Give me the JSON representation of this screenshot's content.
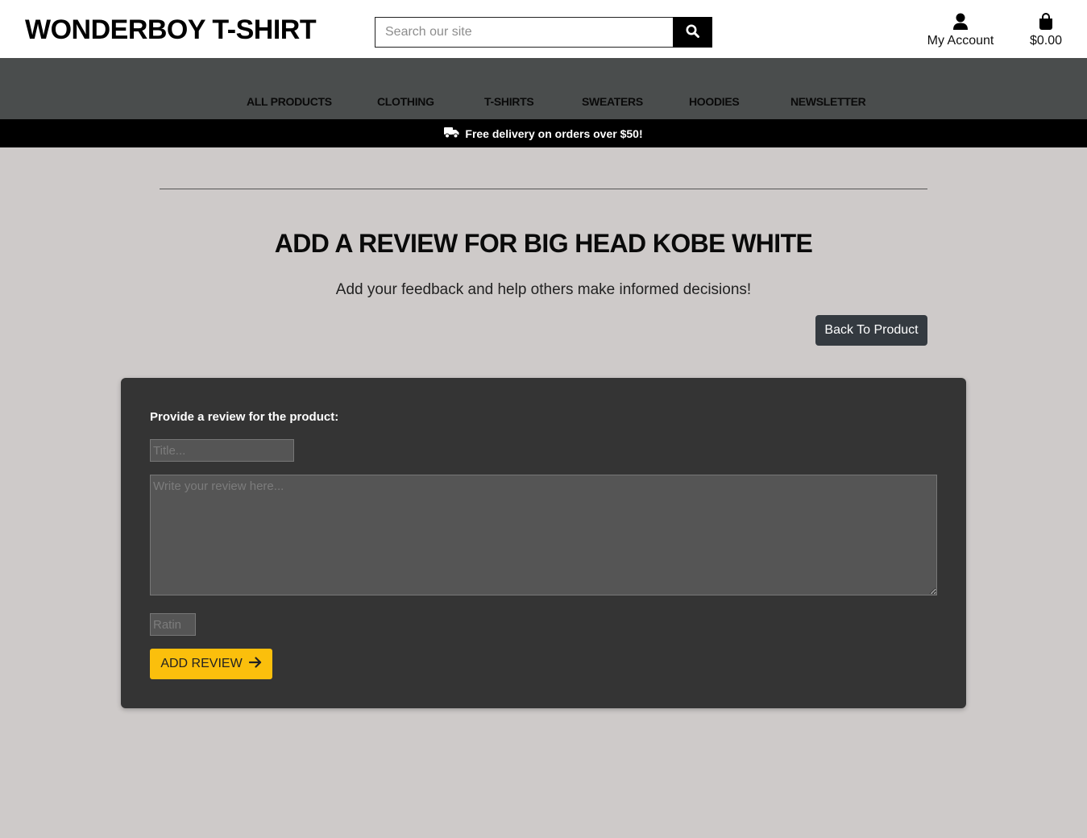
{
  "header": {
    "logo": "WONDERBOY T-SHIRT",
    "search": {
      "placeholder": "Search our site",
      "value": "",
      "button_icon": "search-icon"
    },
    "account": {
      "icon": "user-icon",
      "label": "My Account"
    },
    "bag": {
      "icon": "shopping-bag-icon",
      "total": "$0.00"
    }
  },
  "nav": {
    "items": [
      "ALL PRODUCTS",
      "CLOTHING",
      "T-SHIRTS",
      "SWEATERS",
      "HOODIES",
      "NEWSLETTER"
    ]
  },
  "banner": {
    "icon": "truck-icon",
    "text": "Free delivery on orders over $50!"
  },
  "main": {
    "title": "ADD A REVIEW FOR BIG HEAD KOBE WHITE",
    "subtitle": "Add your feedback and help others make informed decisions!",
    "back_button": "Back To Product"
  },
  "form": {
    "label": "Provide a review for the product:",
    "title_placeholder": "Title...",
    "review_placeholder": "Write your review here...",
    "rating_placeholder": "Ratin",
    "submit_label": "ADD REVIEW",
    "submit_icon": "arrow-right-icon"
  },
  "colors": {
    "page_background": "#cecac9",
    "nav_background": "#4a4d4d",
    "banner_background": "#000000",
    "card_background": "#343434",
    "accent": "#fbbf0c",
    "back_button": "#343a40"
  }
}
